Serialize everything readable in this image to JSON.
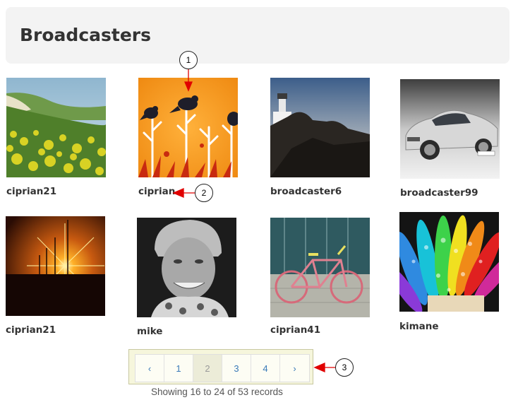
{
  "header": {
    "title": "Broadcasters"
  },
  "broadcasters": [
    {
      "name": "ciprian21",
      "image": "coastal-meadow-photo"
    },
    {
      "name": "ciprian",
      "image": "birds-on-branches-illustration"
    },
    {
      "name": "broadcaster6",
      "image": "lighthouse-sunset-photo"
    },
    {
      "name": "broadcaster99",
      "image": "silver-sports-car-photo"
    },
    {
      "name": "ciprian21",
      "image": "wind-turbines-sunset-photo"
    },
    {
      "name": "mike",
      "image": "man-portrait-photo"
    },
    {
      "name": "ciprian41",
      "image": "bicycle-photo"
    },
    {
      "name": "kimane",
      "image": "rainbow-petals-droplets-photo"
    }
  ],
  "pagination": {
    "prev": "‹",
    "pages": [
      "1",
      "2",
      "3",
      "4"
    ],
    "active": "2",
    "next": "›"
  },
  "records_text": "Showing 16 to 24 of 53 records",
  "callouts": [
    "1",
    "2",
    "3"
  ],
  "colors": {
    "callout_arrow": "#e00000",
    "pager_highlight": "#f6f6dc"
  }
}
